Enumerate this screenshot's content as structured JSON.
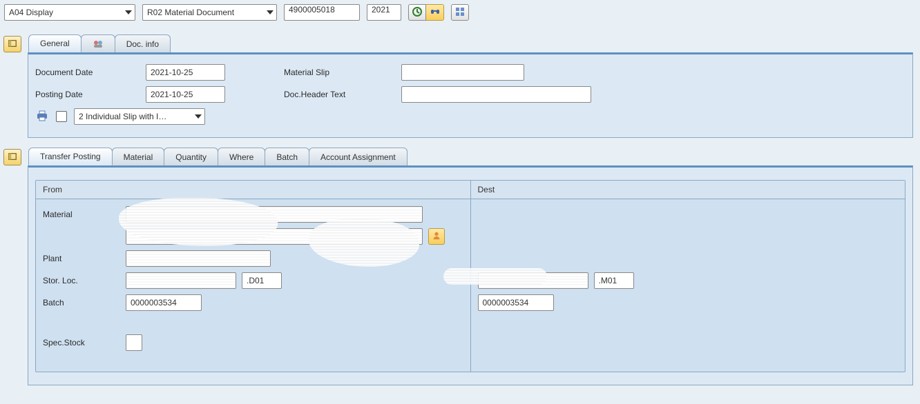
{
  "toolbar": {
    "action_select": "A04 Display",
    "doc_type_select": "R02 Material Document",
    "doc_number": "4900005018",
    "year": "2021"
  },
  "header_tabs": {
    "general": "General",
    "partner_icon": "partner-icon",
    "doc_info": "Doc. info"
  },
  "header_panel": {
    "document_date_label": "Document Date",
    "document_date": "2021-10-25",
    "posting_date_label": "Posting Date",
    "posting_date": "2021-10-25",
    "material_slip_label": "Material Slip",
    "material_slip": "",
    "doc_header_text_label": "Doc.Header Text",
    "doc_header_text": "",
    "slip_select": "2 Individual Slip with I…"
  },
  "detail_tabs": {
    "transfer_posting": "Transfer Posting",
    "material": "Material",
    "quantity": "Quantity",
    "where": "Where",
    "batch": "Batch",
    "account_assignment": "Account Assignment"
  },
  "transfer": {
    "from_label": "From",
    "dest_label": "Dest",
    "material_label": "Material",
    "plant_label": "Plant",
    "stor_loc_label": "Stor. Loc.",
    "batch_label": "Batch",
    "spec_stock_label": "Spec.Stock",
    "from": {
      "material": "",
      "material_desc": "",
      "plant": "",
      "stor_loc_desc": "",
      "stor_loc_code": ".D01",
      "batch": "0000003534",
      "spec_stock": ""
    },
    "dest": {
      "stor_loc_desc": "",
      "stor_loc_code": ".M01",
      "batch": "0000003534"
    }
  }
}
